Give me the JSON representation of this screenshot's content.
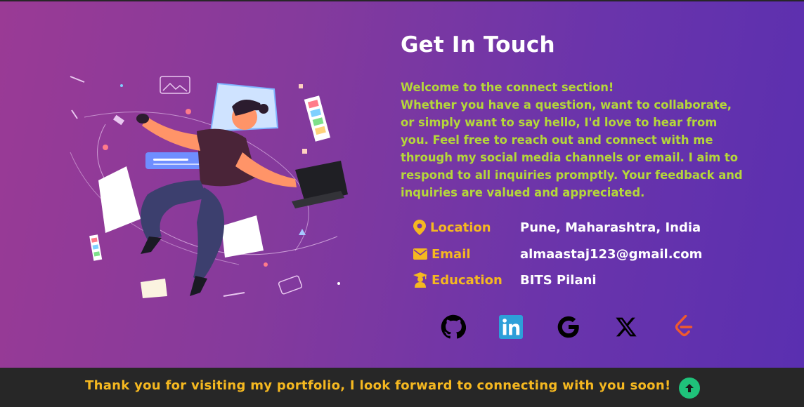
{
  "contact": {
    "title": "Get In Touch",
    "intro_line1": "Welcome to the connect section!",
    "intro_line2": "Whether you have a question, want to collaborate, or simply want to say hello, I'd love to hear from you. Feel free to reach out and connect with me through my social media channels or email. I aim to respond to all inquiries promptly. Your feedback and inquiries are valued and appreciated.",
    "info": [
      {
        "icon": "location-pin-icon",
        "label": "Location",
        "value": "Pune, Maharashtra, India"
      },
      {
        "icon": "envelope-icon",
        "label": "Email",
        "value": "almaastaj123@gmail.com"
      },
      {
        "icon": "graduate-icon",
        "label": "Education",
        "value": "BITS Pilani"
      }
    ],
    "socials": [
      "github-icon",
      "linkedin-icon",
      "google-icon",
      "x-icon",
      "leetcode-icon"
    ]
  },
  "footer": {
    "message": "Thank you for visiting my portfolio, I look forward to connecting with you soon!",
    "scroll_top_icon": "arrow-up-icon"
  },
  "colors": {
    "accent_green": "#b5d73a",
    "accent_yellow": "#f5b820",
    "scroll_button": "#1fc27a",
    "footer_bg": "#272727"
  }
}
